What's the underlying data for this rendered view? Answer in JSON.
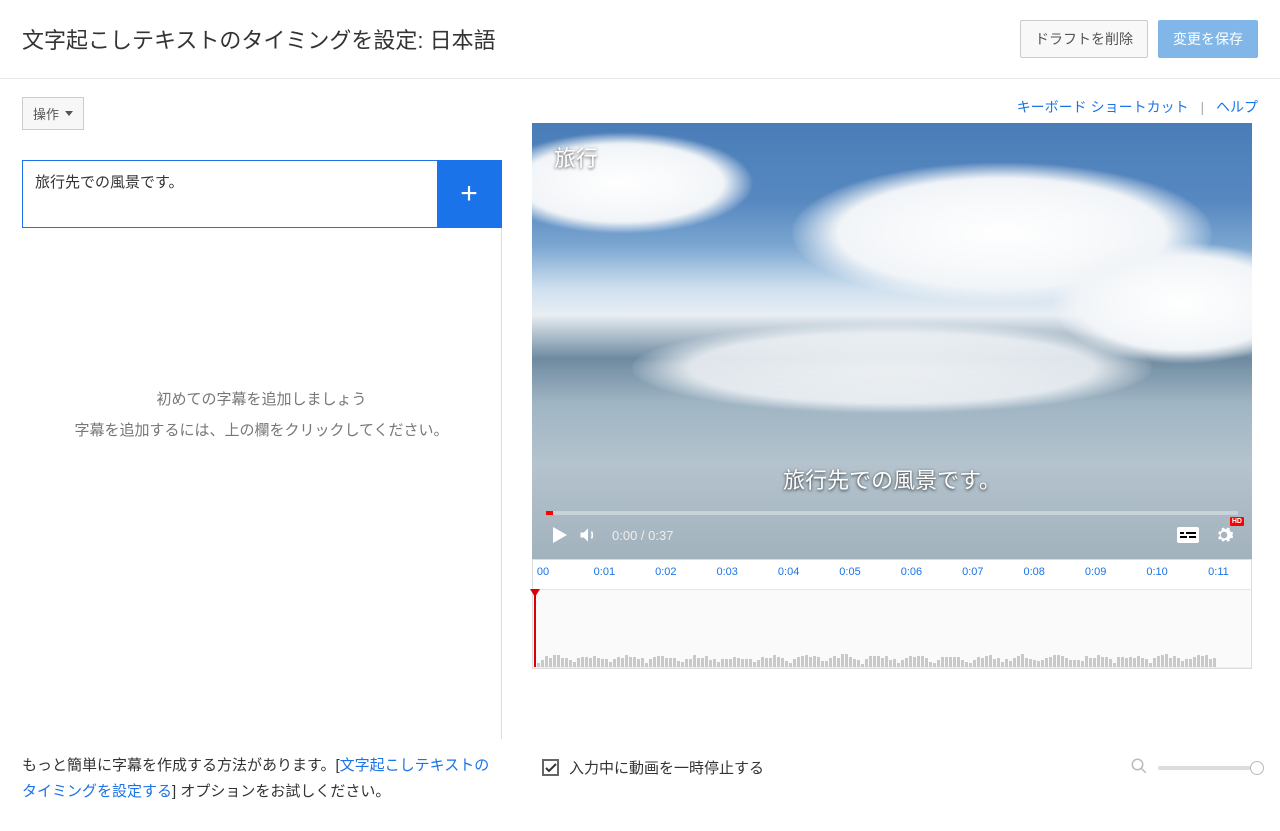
{
  "header": {
    "title": "文字起こしテキストのタイミングを設定: 日本語",
    "delete_draft": "ドラフトを削除",
    "save_changes": "変更を保存"
  },
  "actions_dropdown": {
    "label": "操作"
  },
  "top_links": {
    "keyboard_shortcuts": "キーボード ショートカット",
    "help": "ヘルプ"
  },
  "caption_input": {
    "value": "旅行先での風景です。"
  },
  "caption_list": {
    "empty_line1": "初めての字幕を追加しましょう",
    "empty_line2": "字幕を追加するには、上の欄をクリックしてください。"
  },
  "video": {
    "overlay_title": "旅行",
    "overlay_caption": "旅行先での風景です。",
    "time_current": "0:00",
    "time_sep": " / ",
    "time_total": "0:37"
  },
  "timeline": {
    "ticks": [
      "00",
      "0:01",
      "0:02",
      "0:03",
      "0:04",
      "0:05",
      "0:06",
      "0:07",
      "0:08",
      "0:09",
      "0:10",
      "0:11"
    ]
  },
  "footer": {
    "hint_prefix": "もっと簡単に字幕を作成する方法があります。[",
    "hint_link": "文字起こしテキストのタイミングを設定する",
    "hint_suffix": "] オプションをお試しください。",
    "pause_checkbox": "入力中に動画を一時停止する",
    "pause_checked": true
  }
}
